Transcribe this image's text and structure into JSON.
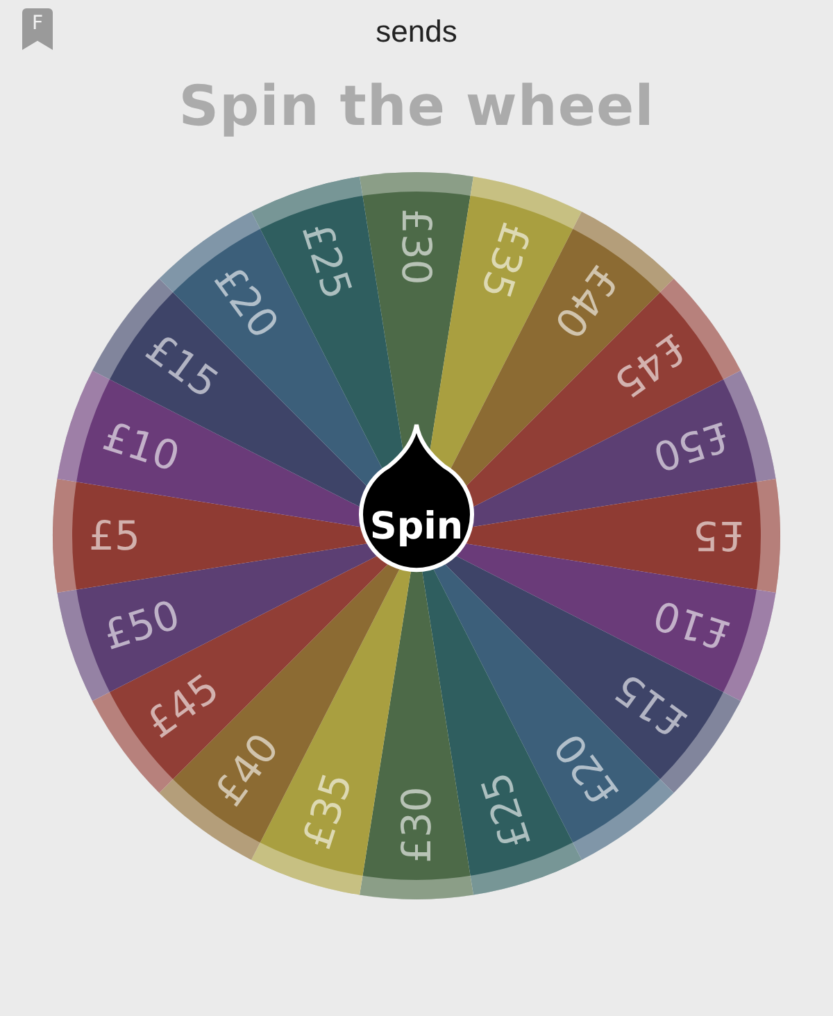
{
  "header": {
    "badge": "F",
    "title": "sends"
  },
  "heading": "Spin the wheel",
  "wheel": {
    "button": "Spin",
    "segments": [
      {
        "label": "£30",
        "color": "#4d6a48"
      },
      {
        "label": "£35",
        "color": "#a99f40"
      },
      {
        "label": "£40",
        "color": "#8c6b33"
      },
      {
        "label": "£45",
        "color": "#913e36"
      },
      {
        "label": "£50",
        "color": "#5c3f73"
      },
      {
        "label": "£5",
        "color": "#8f3b33"
      },
      {
        "label": "£10",
        "color": "#6a3b79"
      },
      {
        "label": "£15",
        "color": "#3e4468"
      },
      {
        "label": "£20",
        "color": "#3c5f7a"
      },
      {
        "label": "£25",
        "color": "#2f5e5f"
      },
      {
        "label": "£30",
        "color": "#4d6a48"
      },
      {
        "label": "£35",
        "color": "#a99f40"
      },
      {
        "label": "£40",
        "color": "#8c6b33"
      },
      {
        "label": "£45",
        "color": "#913e36"
      },
      {
        "label": "£50",
        "color": "#5c3f73"
      },
      {
        "label": "£5",
        "color": "#8f3b33"
      },
      {
        "label": "£10",
        "color": "#6a3b79"
      },
      {
        "label": "£15",
        "color": "#3e4468"
      },
      {
        "label": "£20",
        "color": "#3c5f7a"
      },
      {
        "label": "£25",
        "color": "#2f5e5f"
      }
    ]
  }
}
